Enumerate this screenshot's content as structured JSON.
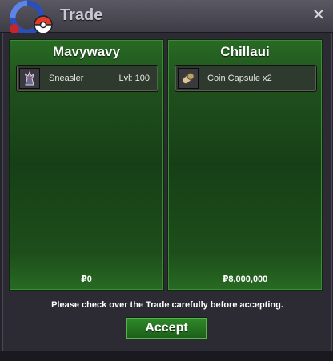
{
  "window": {
    "title": "Trade",
    "close_label": "✕"
  },
  "left_panel": {
    "player": "Mavywavy",
    "items": [
      {
        "icon": "sneasler-sprite-icon",
        "name": "Sneasler",
        "detail": "Lvl: 100"
      }
    ],
    "money": "₽0"
  },
  "right_panel": {
    "player": "Chillaui",
    "items": [
      {
        "icon": "coin-capsule-icon",
        "name": "Coin Capsule",
        "detail": "x2"
      }
    ],
    "money": "₽8,000,000"
  },
  "footer": {
    "notice": "Please check over the Trade carefully before accepting.",
    "accept_label": "Accept"
  },
  "colors": {
    "panel_green": "#1f4f1c",
    "window_bg": "#2c2a33",
    "title_bar": "#4a4852"
  }
}
